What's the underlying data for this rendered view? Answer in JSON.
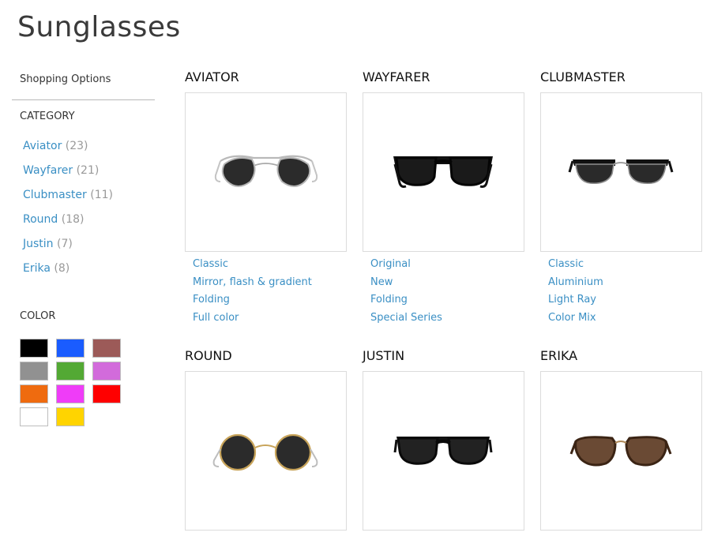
{
  "page": {
    "title": "Sunglasses"
  },
  "sidebar": {
    "shopping_options": "Shopping Options",
    "category_title": "CATEGORY",
    "categories": [
      {
        "label": "Aviator",
        "count": "(23)"
      },
      {
        "label": "Wayfarer",
        "count": "(21)"
      },
      {
        "label": "Clubmaster",
        "count": "(11)"
      },
      {
        "label": "Round",
        "count": "(18)"
      },
      {
        "label": "Justin",
        "count": "(7)"
      },
      {
        "label": "Erika",
        "count": "(8)"
      }
    ],
    "color_title": "COLOR",
    "colors": [
      "#000000",
      "#1a5cff",
      "#9c5a58",
      "#919191",
      "#53a934",
      "#d26bdb",
      "#ef6b0f",
      "#ef3cf8",
      "#ff0000",
      "#ffffff",
      "#ffd400"
    ]
  },
  "products": [
    {
      "title": "AVIATOR",
      "icon": "aviator-sunglasses-icon",
      "links": [
        "Classic",
        "Mirror, flash & gradient",
        "Folding",
        "Full color"
      ]
    },
    {
      "title": "WAYFARER",
      "icon": "wayfarer-sunglasses-icon",
      "links": [
        "Original",
        "New",
        "Folding",
        "Special Series"
      ]
    },
    {
      "title": "CLUBMASTER",
      "icon": "clubmaster-sunglasses-icon",
      "links": [
        "Classic",
        "Aluminium",
        "Light Ray",
        "Color Mix"
      ]
    },
    {
      "title": "ROUND",
      "icon": "round-sunglasses-icon",
      "links": []
    },
    {
      "title": "JUSTIN",
      "icon": "justin-sunglasses-icon",
      "links": []
    },
    {
      "title": "ERIKA",
      "icon": "erika-sunglasses-icon",
      "links": []
    }
  ]
}
